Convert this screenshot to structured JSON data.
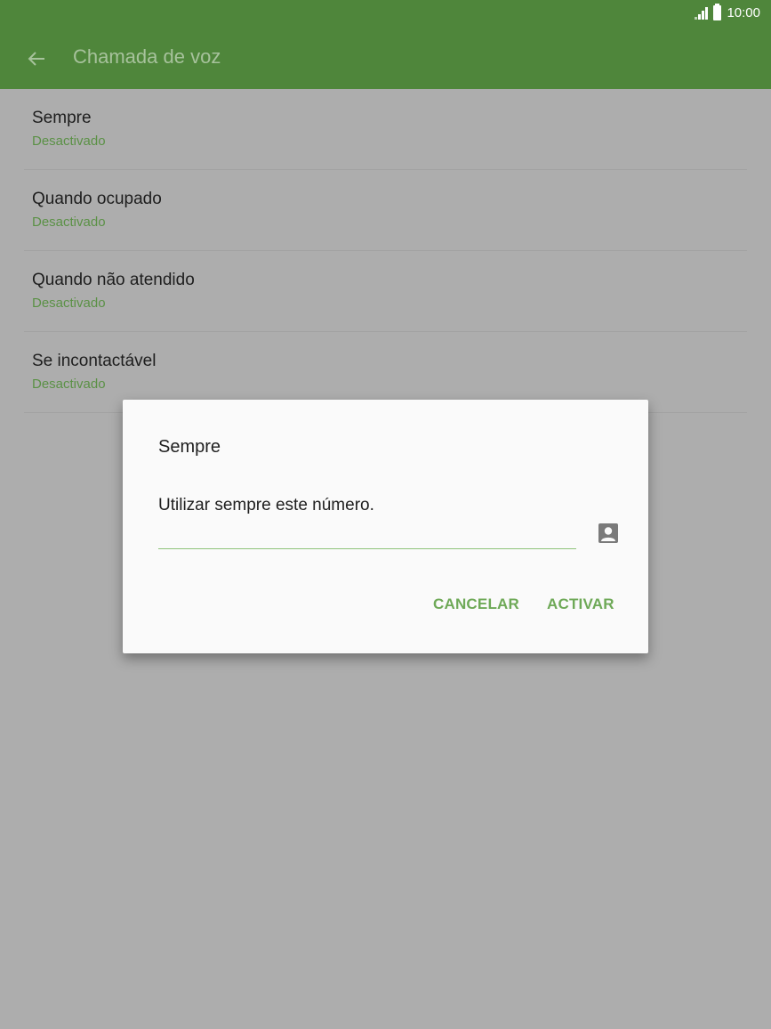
{
  "status_bar": {
    "time": "10:00",
    "signal_icon": "signal-icon",
    "battery_icon": "battery-icon"
  },
  "app_bar": {
    "back_icon": "arrow-left-icon",
    "title": "Chamada de voz",
    "color": "#4f863b"
  },
  "list": {
    "items": [
      {
        "title": "Sempre",
        "status": "Desactivado"
      },
      {
        "title": "Quando ocupado",
        "status": "Desactivado"
      },
      {
        "title": "Quando não atendido",
        "status": "Desactivado"
      },
      {
        "title": "Se incontactável",
        "status": "Desactivado"
      }
    ]
  },
  "dialog": {
    "title": "Sempre",
    "message": "Utilizar sempre este número.",
    "input_value": "",
    "input_placeholder": "",
    "contact_icon": "contact-picker-icon",
    "cancel_label": "CANCELAR",
    "activate_label": "ACTIVAR",
    "accent_color": "#6ea957"
  }
}
